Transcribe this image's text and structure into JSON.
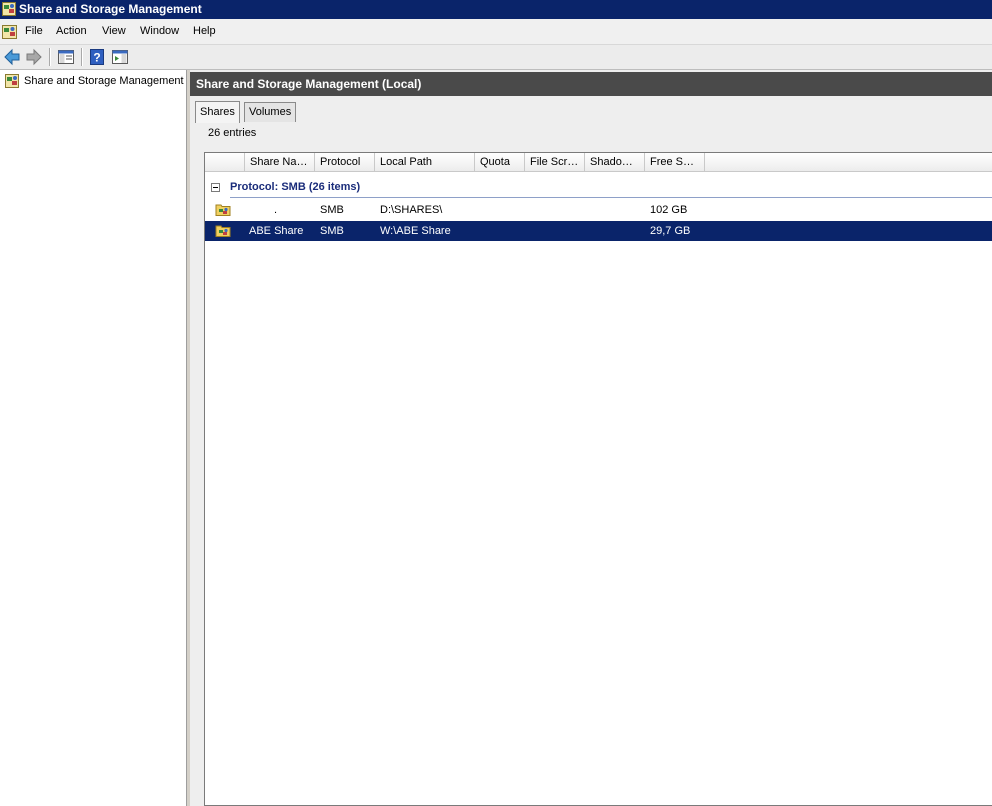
{
  "window": {
    "title": "Share and Storage Management"
  },
  "menu": [
    "File",
    "Action",
    "View",
    "Window",
    "Help"
  ],
  "toolbar": {
    "buttons": [
      "back-icon",
      "forward-icon",
      "show-hide-console-tree-icon",
      "help-icon",
      "show-hide-action-pane-icon"
    ]
  },
  "tree": {
    "root_label": "Share and Storage Management ("
  },
  "results": {
    "header_title": "Share and Storage Management (Local)",
    "tabs": [
      "Shares",
      "Volumes"
    ],
    "active_tab": "Shares",
    "entry_count": "26 entries",
    "columns": [
      "Share Na…",
      "Protocol",
      "Local Path",
      "Quota",
      "File Scr…",
      "Shado…",
      "Free S…"
    ],
    "group_label": "Protocol: SMB (26 items)",
    "rows": [
      {
        "share_name": ".",
        "protocol": "SMB",
        "local_path": "D:\\SHARES\\",
        "quota": "",
        "file_screening": "",
        "shadow_copies": "",
        "free_space": "102 GB",
        "selected": false
      },
      {
        "share_name": "ABE Share",
        "protocol": "SMB",
        "local_path": "W:\\ABE Share",
        "quota": "",
        "file_screening": "",
        "shadow_copies": "",
        "free_space": "29,7 GB",
        "selected": true
      }
    ]
  },
  "colors": {
    "title_bar": "#0a246a",
    "selection": "#0a246a",
    "result_header": "#4a4a4a",
    "group_label": "#1a2c7a"
  }
}
